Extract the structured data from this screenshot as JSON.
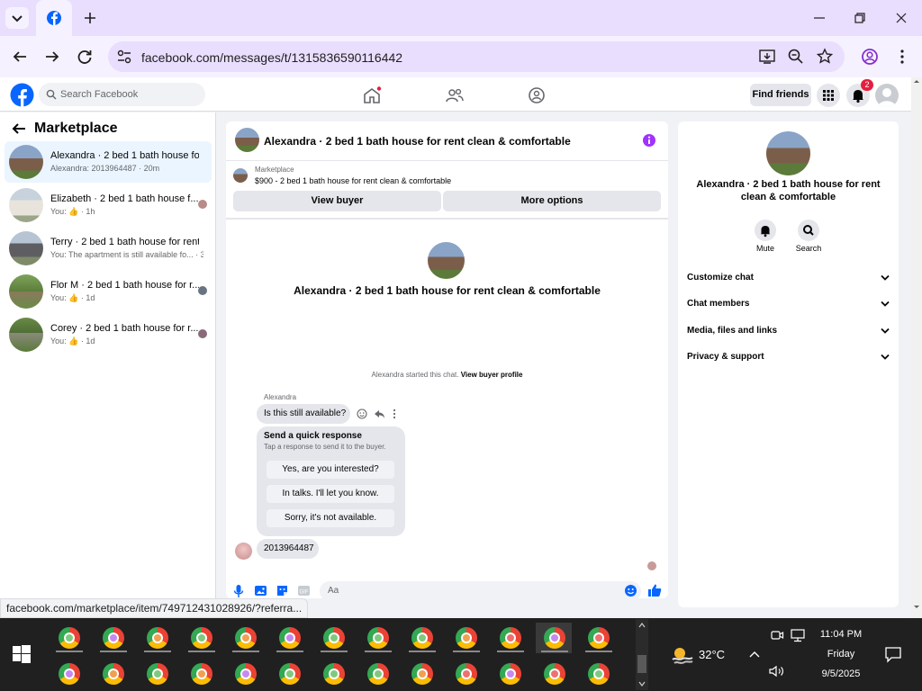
{
  "browser": {
    "url": "facebook.com/messages/t/1315836590116442",
    "status_url": "facebook.com/marketplace/item/749712431028926/?referra..."
  },
  "header": {
    "search_placeholder": "Search Facebook",
    "find_friends": "Find friends",
    "notification_count": "2"
  },
  "sidebar": {
    "title": "Marketplace",
    "conversations": [
      {
        "title": "Alexandra · 2 bed 1 bath house for...",
        "preview": "Alexandra: 2013964487 · 20m"
      },
      {
        "title": "Elizabeth · 2 bed 1 bath house f...",
        "preview": "You: 👍 · 1h"
      },
      {
        "title": "Terry · 2 bed 1 bath house for rent ...",
        "preview": "You: The apartment is still available fo... · 3h"
      },
      {
        "title": "Flor M · 2 bed 1 bath house for r...",
        "preview": "You: 👍 · 1d"
      },
      {
        "title": "Corey · 2 bed 1 bath house for r...",
        "preview": "You: 👍 · 1d"
      }
    ]
  },
  "chat": {
    "header_title": "Alexandra · 2 bed 1 bath house for rent clean & comfortable",
    "listing_label": "Marketplace",
    "listing_price": "$900 - 2 bed 1 bath house for rent clean & comfortable",
    "view_buyer": "View buyer",
    "more_options": "More options",
    "center_name": "Alexandra · 2 bed 1 bath house for rent clean & comfortable",
    "started_text": "Alexandra started this chat.",
    "view_buyer_profile": "View buyer profile",
    "sender": "Alexandra",
    "message1": "Is this still available?",
    "quick_title": "Send a quick response",
    "quick_sub": "Tap a response to send it to the buyer.",
    "quick_replies": [
      "Yes, are you interested?",
      "In talks. I'll let you know.",
      "Sorry, it's not available."
    ],
    "message2": "2013964487",
    "composer_placeholder": "Aa"
  },
  "details": {
    "name": "Alexandra · 2 bed 1 bath house for rent clean & comfortable",
    "mute": "Mute",
    "search": "Search",
    "sections": [
      "Customize chat",
      "Chat members",
      "Media, files and links",
      "Privacy & support"
    ]
  },
  "taskbar": {
    "temperature": "32°C",
    "time": "11:04 PM",
    "day": "Friday",
    "date": "9/5/2025"
  },
  "colors": {
    "accent": "#0866ff",
    "purple": "#a033ff",
    "taskbar": "#202020"
  }
}
